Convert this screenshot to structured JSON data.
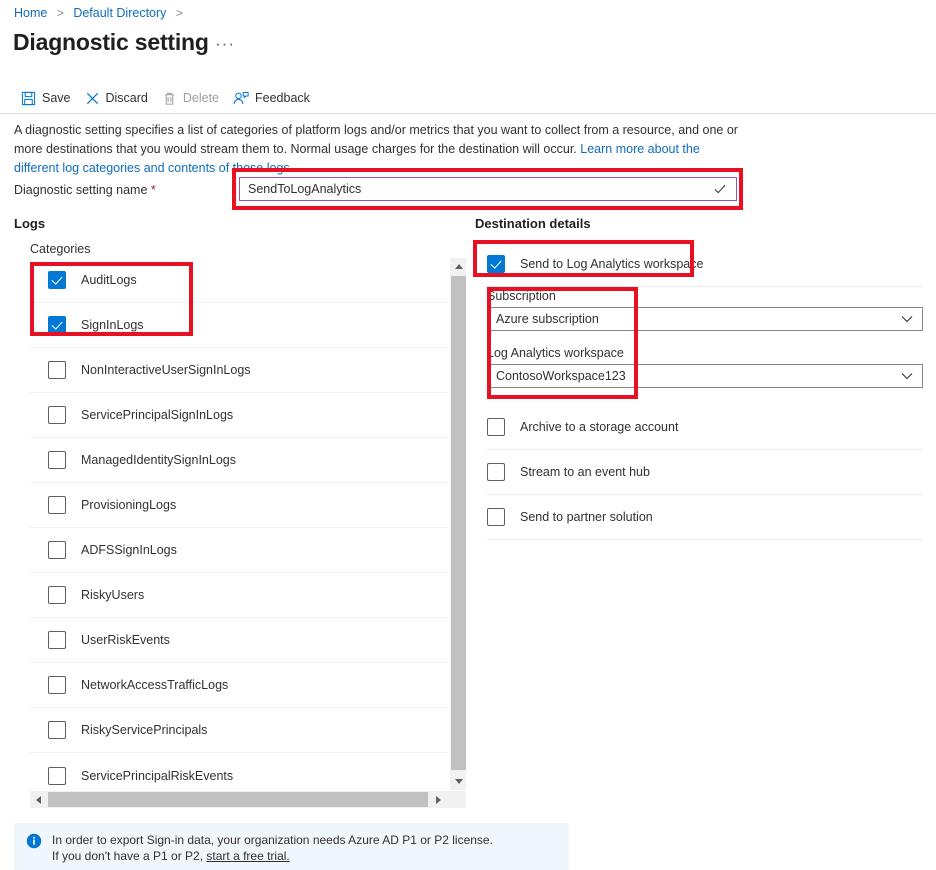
{
  "breadcrumb": {
    "items": [
      {
        "label": "Home"
      },
      {
        "label": "Default Directory"
      }
    ],
    "separator": ">"
  },
  "header": {
    "title": "Diagnostic setting",
    "ellipsis": "···"
  },
  "toolbar": {
    "save_label": "Save",
    "discard_label": "Discard",
    "delete_label": "Delete",
    "feedback_label": "Feedback"
  },
  "description": {
    "part1": "A diagnostic setting specifies a list of categories of platform logs and/or metrics that you want to collect from a resource, and one or more destinations that you would stream them to. Normal usage charges for the destination will occur. ",
    "link": "Learn more about the different log categories and contents of those logs"
  },
  "name_field": {
    "label": "Diagnostic setting name",
    "required_marker": "*",
    "value": "SendToLogAnalytics",
    "placeholder": "",
    "validation_icon": "check-icon",
    "border_color": "#9b51b0"
  },
  "logs": {
    "heading": "Logs",
    "categories_label": "Categories",
    "items": [
      {
        "label": "AuditLogs",
        "checked": true
      },
      {
        "label": "SignInLogs",
        "checked": true
      },
      {
        "label": "NonInteractiveUserSignInLogs",
        "checked": false
      },
      {
        "label": "ServicePrincipalSignInLogs",
        "checked": false
      },
      {
        "label": "ManagedIdentitySignInLogs",
        "checked": false
      },
      {
        "label": "ProvisioningLogs",
        "checked": false
      },
      {
        "label": "ADFSSignInLogs",
        "checked": false
      },
      {
        "label": "RiskyUsers",
        "checked": false
      },
      {
        "label": "UserRiskEvents",
        "checked": false
      },
      {
        "label": "NetworkAccessTrafficLogs",
        "checked": false
      },
      {
        "label": "RiskyServicePrincipals",
        "checked": false
      },
      {
        "label": "ServicePrincipalRiskEvents",
        "checked": false
      }
    ]
  },
  "destination": {
    "heading": "Destination details",
    "log_analytics": {
      "label": "Send to Log Analytics workspace",
      "checked": true
    },
    "subscription": {
      "label": "Subscription",
      "value": "Azure subscription"
    },
    "workspace": {
      "label": "Log Analytics workspace",
      "value": "ContosoWorkspace123"
    },
    "other_options": [
      {
        "label": "Archive to a storage account",
        "checked": false
      },
      {
        "label": "Stream to an event hub",
        "checked": false
      },
      {
        "label": "Send to partner solution",
        "checked": false
      }
    ]
  },
  "info_banner": {
    "icon": "info-icon",
    "line1": "In order to export Sign-in data, your organization needs Azure AD P1 or P2 license.",
    "line2_prefix": "If you don't have a P1 or P2, ",
    "line2_link": "start a free trial."
  },
  "colors": {
    "accent": "#0078d4",
    "link": "#0f6cbd",
    "annotation_red": "#e81123",
    "info_background": "#eff6fc",
    "checkbox_checked": "#0078d4"
  },
  "annotations": [
    {
      "name": "name-field-highlight"
    },
    {
      "name": "selected-categories-highlight"
    },
    {
      "name": "send-to-log-analytics-highlight"
    },
    {
      "name": "workspace-fields-highlight"
    }
  ]
}
